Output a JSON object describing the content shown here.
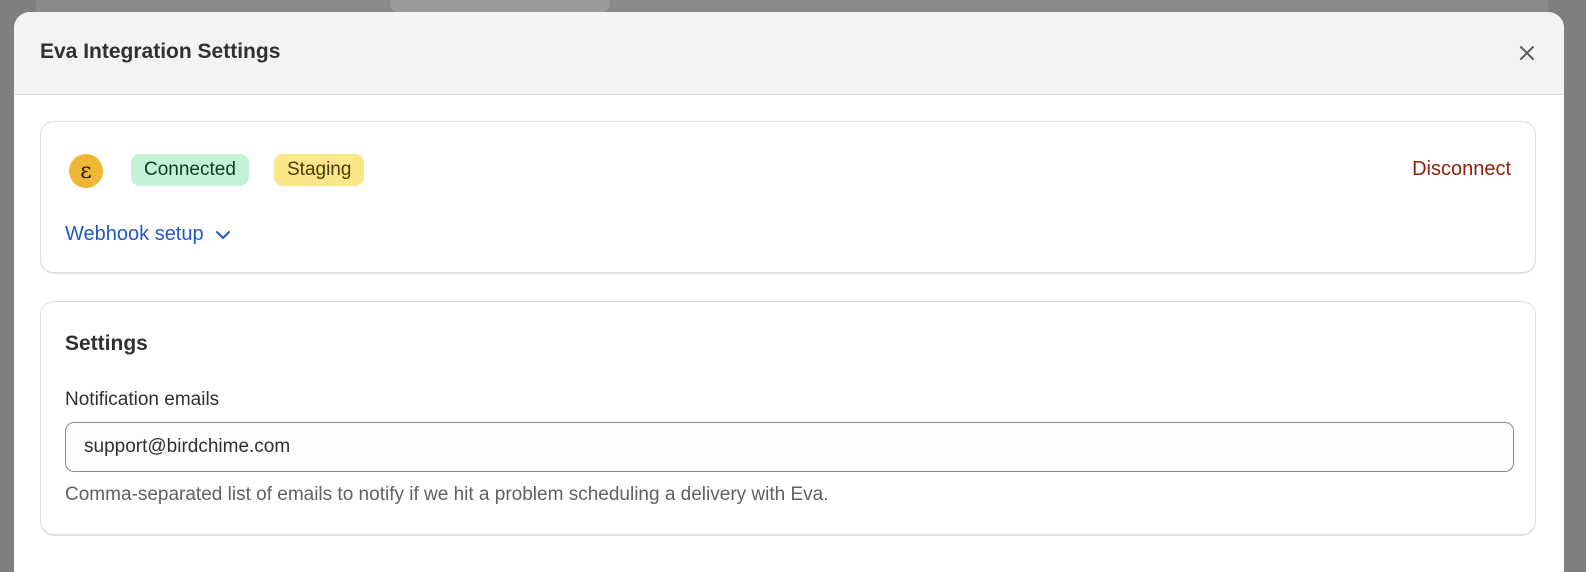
{
  "modal": {
    "title": "Eva Integration Settings",
    "close_icon": "close-icon"
  },
  "integration": {
    "logo_icon": "eva-logo-icon",
    "logo_glyph": "ε",
    "status_badge": "Connected",
    "environment_badge": "Staging",
    "disconnect_label": "Disconnect",
    "webhook_label": "Webhook setup",
    "webhook_icon": "chevron-down-icon"
  },
  "settings": {
    "title": "Settings",
    "notification_label": "Notification emails",
    "notification_value": "support@birdchime.com",
    "help_text": "Comma-separated list of emails to notify if we hit a problem scheduling a delivery with Eva."
  },
  "colors": {
    "overlay": "#7f7f7f",
    "connected_bg": "#c4f2d5",
    "staging_bg": "#fbe68a",
    "logo_bg": "#f0b734",
    "link_blue": "#1f56c8",
    "critical_red": "#8e1f0b"
  }
}
